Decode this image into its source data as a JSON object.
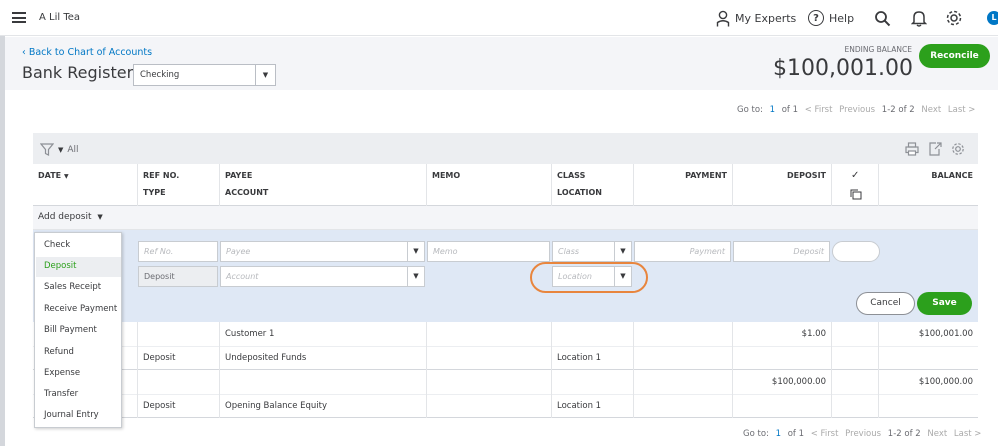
{
  "company": "A Lil Tea",
  "top_nav": {
    "my_experts": "My Experts",
    "help": "Help",
    "avatar_letter": "L"
  },
  "header": {
    "back_link": "Back to Chart of Accounts",
    "title": "Bank Register",
    "account_select": "Checking",
    "ending_label": "ENDING BALANCE",
    "ending_amount": "$100,001.00",
    "reconcile": "Reconcile"
  },
  "pager": {
    "goto": "Go to:",
    "page": "1",
    "of": "of 1",
    "first": "< First",
    "previous": "Previous",
    "range": "1-2 of 2",
    "next": "Next",
    "last": "Last >"
  },
  "toolbar": {
    "filter_label": "All"
  },
  "columns": {
    "date": "DATE",
    "ref_no": "REF NO.",
    "type": "TYPE",
    "payee": "PAYEE",
    "account": "ACCOUNT",
    "memo": "MEMO",
    "class": "CLASS",
    "location": "LOCATION",
    "payment": "PAYMENT",
    "deposit": "DEPOSIT",
    "check": "✓",
    "balance": "BALANCE"
  },
  "add_deposit": "Add deposit",
  "edit_row": {
    "ref_no_placeholder": "Ref No.",
    "payee_placeholder": "Payee",
    "memo_placeholder": "Memo",
    "class_placeholder": "Class",
    "payment_placeholder": "Payment",
    "deposit_placeholder": "Deposit",
    "type_value": "Deposit",
    "account_placeholder": "Account",
    "location_placeholder": "Location",
    "cancel": "Cancel",
    "save": "Save"
  },
  "type_menu": [
    "Check",
    "Deposit",
    "Sales Receipt",
    "Receive Payment",
    "Bill Payment",
    "Refund",
    "Expense",
    "Transfer",
    "Journal Entry"
  ],
  "rows": [
    {
      "payee": "Customer 1",
      "type": "Deposit",
      "account": "Undeposited Funds",
      "location": "Location 1",
      "deposit": "$1.00",
      "balance": "$100,001.00"
    },
    {
      "payee": "",
      "type": "Deposit",
      "account": "Opening Balance Equity",
      "location": "Location 1",
      "deposit": "$100,000.00",
      "balance": "$100,000.00"
    }
  ],
  "colors": {
    "accent_green": "#2ca01c",
    "link_blue": "#0077c5",
    "highlight_orange": "#e8853d"
  }
}
